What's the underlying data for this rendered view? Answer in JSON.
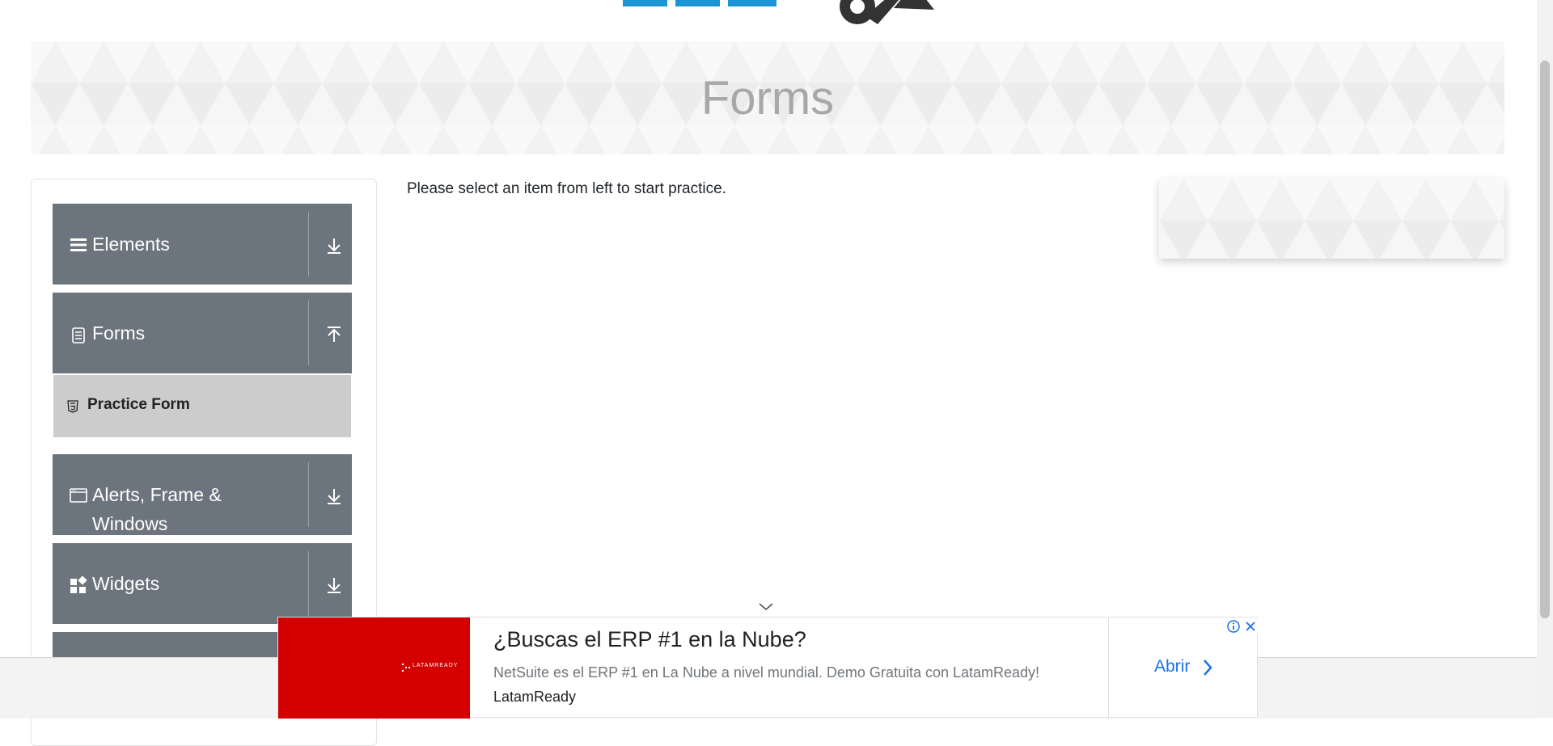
{
  "banner": {
    "title": "Forms"
  },
  "sidebar": {
    "groups": [
      {
        "label": "Elements",
        "icon": "hamburger-icon",
        "state": "collapsed"
      },
      {
        "label": "Forms",
        "icon": "document-icon",
        "state": "expanded"
      },
      {
        "label": "Alerts, Frame &",
        "label2": "Windows",
        "icon": "window-icon",
        "state": "collapsed"
      },
      {
        "label": "Widgets",
        "icon": "widgets-icon",
        "state": "collapsed"
      }
    ],
    "sub_items": [
      {
        "label": "Practice Form",
        "icon": "html5-icon"
      }
    ]
  },
  "main": {
    "message": "Please select an item from left to start practice."
  },
  "ad": {
    "headline": "¿Buscas el ERP #1 en la Nube?",
    "description": "NetSuite es el ERP #1 en La Nube a nivel mundial. Demo Gratuita con LatamReady!",
    "advertiser": "LatamReady",
    "cta": "Abrir",
    "logo_text": "LATAMREADY",
    "colors": {
      "brand": "#d40000",
      "cta": "#1a73e8"
    }
  },
  "colors": {
    "sidebar_group_bg": "#6c757d",
    "sub_item_bg": "#cccccc",
    "banner_text": "#a8a8a8"
  }
}
